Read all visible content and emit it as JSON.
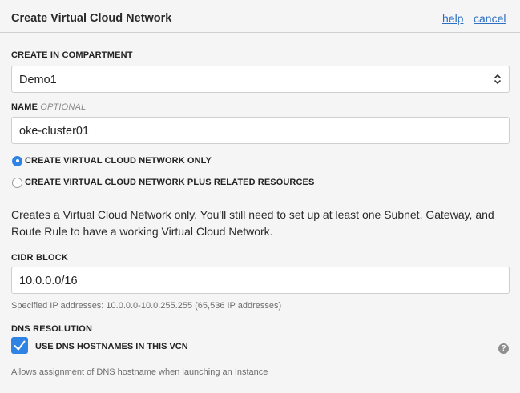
{
  "header": {
    "title": "Create Virtual Cloud Network",
    "help_label": "help",
    "cancel_label": "cancel"
  },
  "compartment": {
    "label": "CREATE IN COMPARTMENT",
    "selected": "Demo1"
  },
  "name": {
    "label": "NAME",
    "optional": "OPTIONAL",
    "value": "oke-cluster01"
  },
  "options": [
    {
      "label": "CREATE VIRTUAL CLOUD NETWORK ONLY",
      "selected": true
    },
    {
      "label": "CREATE VIRTUAL CLOUD NETWORK PLUS RELATED RESOURCES",
      "selected": false
    }
  ],
  "description": "Creates a Virtual Cloud Network only. You'll still need to set up at least one Subnet, Gateway, and Route Rule to have a working Virtual Cloud Network.",
  "cidr": {
    "label": "CIDR BLOCK",
    "value": "10.0.0.0/16",
    "hint": "Specified IP addresses: 10.0.0.0-10.0.255.255 (65,536 IP addresses)"
  },
  "dns": {
    "label": "DNS RESOLUTION",
    "checkbox_label": "USE DNS HOSTNAMES IN THIS VCN",
    "checked": true,
    "hint": "Allows assignment of DNS hostname when launching an Instance",
    "help_icon": "?"
  },
  "colors": {
    "accent": "#2e83e5",
    "link": "#2d6fc4"
  },
  "icons": {
    "select": "chevron-up-down-icon",
    "check": "checkmark-icon",
    "help": "question-circle-icon"
  }
}
